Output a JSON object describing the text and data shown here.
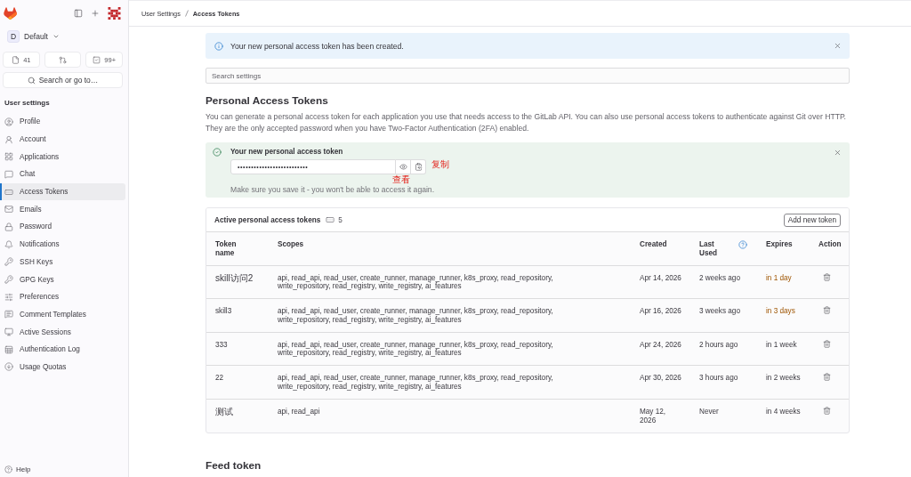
{
  "sidebar": {
    "project": {
      "initial": "D",
      "name": "Default"
    },
    "counters": [
      {
        "kind": "issues",
        "count": "41"
      },
      {
        "kind": "merge_requests"
      },
      {
        "kind": "todos",
        "count": "99+"
      }
    ],
    "search_label": "Search or go to…",
    "section_title": "User settings",
    "items": [
      {
        "label": "Profile",
        "selected": false
      },
      {
        "label": "Account",
        "selected": false
      },
      {
        "label": "Applications",
        "selected": false
      },
      {
        "label": "Chat",
        "selected": false
      },
      {
        "label": "Access Tokens",
        "selected": true
      },
      {
        "label": "Emails",
        "selected": false
      },
      {
        "label": "Password",
        "selected": false
      },
      {
        "label": "Notifications",
        "selected": false
      },
      {
        "label": "SSH Keys",
        "selected": false
      },
      {
        "label": "GPG Keys",
        "selected": false
      },
      {
        "label": "Preferences",
        "selected": false
      },
      {
        "label": "Comment Templates",
        "selected": false
      },
      {
        "label": "Active Sessions",
        "selected": false
      },
      {
        "label": "Authentication Log",
        "selected": false
      },
      {
        "label": "Usage Quotas",
        "selected": false
      }
    ],
    "help_label": "Help"
  },
  "breadcrumbs": [
    {
      "label": "User Settings",
      "current": false
    },
    {
      "label": "Access Tokens",
      "current": true
    }
  ],
  "alert": {
    "message": "Your new personal access token has been created."
  },
  "search": {
    "placeholder": "Search settings"
  },
  "section": {
    "title": "Personal Access Tokens",
    "description": "You can generate a personal access token for each application you use that needs access to the GitLab API. You can also use personal access tokens to authenticate against Git over HTTP. They are the only accepted password when you have Two-Factor Authentication (2FA) enabled."
  },
  "new_token": {
    "title": "Your new personal access token",
    "value": "••••••••••••••••••••••••••",
    "hint": "Make sure you save it - you won't be able to access it again.",
    "annotations": [
      {
        "kind": "copy",
        "text": "复制"
      },
      {
        "kind": "reveal",
        "text": "查看"
      }
    ]
  },
  "tokens": {
    "title": "Active personal access tokens",
    "count": "5",
    "add_button": "Add new token",
    "columns": [
      {
        "label": "Token name",
        "help": false
      },
      {
        "label": "Scopes",
        "help": false
      },
      {
        "label": "Created",
        "help": false
      },
      {
        "label": "Last Used",
        "help": true
      },
      {
        "label": "Expires",
        "help": false
      },
      {
        "label": "Action",
        "help": false
      }
    ],
    "rows": [
      {
        "name": "skill访问2",
        "scopes": "api, read_api, read_user, create_runner, manage_runner, k8s_proxy, read_repository, write_repository, read_registry, write_registry, ai_features",
        "created": "Apr 14, 2026",
        "last_used": "2 weeks ago",
        "expires": "in 1 day",
        "expiring_soon": true
      },
      {
        "name": "skill3",
        "scopes": "api, read_api, read_user, create_runner, manage_runner, k8s_proxy, read_repository, write_repository, read_registry, write_registry, ai_features",
        "created": "Apr 16, 2026",
        "last_used": "3 weeks ago",
        "expires": "in 3 days",
        "expiring_soon": true
      },
      {
        "name": "333",
        "scopes": "api, read_api, read_user, create_runner, manage_runner, k8s_proxy, read_repository, write_repository, read_registry, write_registry, ai_features",
        "created": "Apr 24, 2026",
        "last_used": "2 hours ago",
        "expires": "in 1 week",
        "expiring_soon": false
      },
      {
        "name": "22",
        "scopes": "api, read_api, read_user, create_runner, manage_runner, k8s_proxy, read_repository, write_repository, read_registry, write_registry, ai_features",
        "created": "Apr 30, 2026",
        "last_used": "3 hours ago",
        "expires": "in 2 weeks",
        "expiring_soon": false
      },
      {
        "name": "测试",
        "scopes": "api, read_api",
        "created": "May 12, 2026",
        "last_used": "Never",
        "expires": "in 4 weeks",
        "expiring_soon": false
      }
    ]
  },
  "feed_token": {
    "title": "Feed token"
  }
}
